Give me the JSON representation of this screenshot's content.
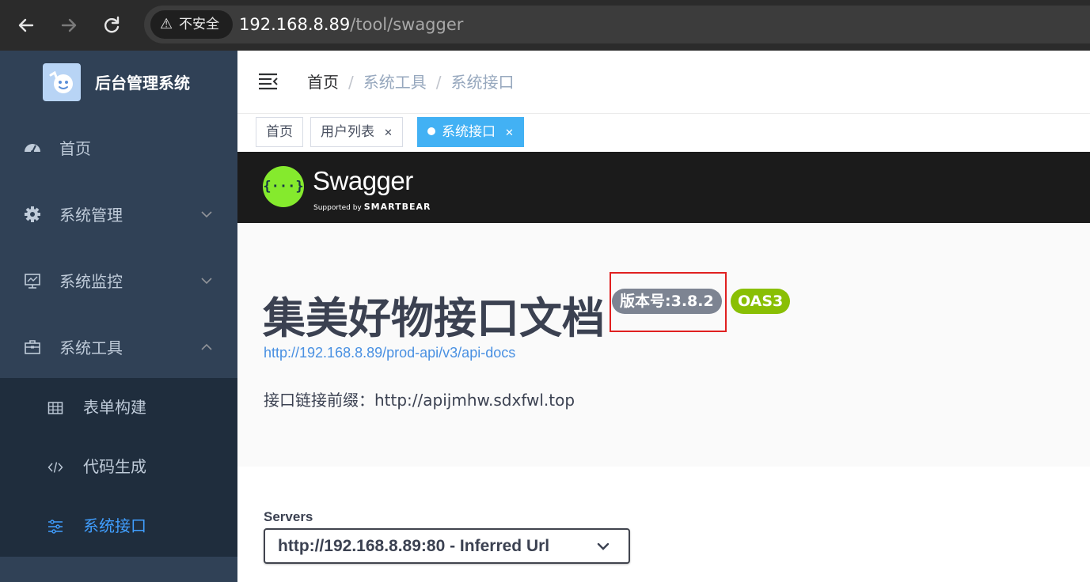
{
  "browser": {
    "security_label": "不安全",
    "url_host": "192.168.8.89",
    "url_path": "/tool/swagger"
  },
  "sidebar": {
    "title": "后台管理系统",
    "items": [
      {
        "label": "首页",
        "icon": "dashboard-icon"
      },
      {
        "label": "系统管理",
        "icon": "gear-icon"
      },
      {
        "label": "系统监控",
        "icon": "monitor-icon"
      },
      {
        "label": "系统工具",
        "icon": "toolbox-icon"
      }
    ],
    "subitems": [
      {
        "label": "表单构建",
        "icon": "table-icon"
      },
      {
        "label": "代码生成",
        "icon": "code-icon"
      },
      {
        "label": "系统接口",
        "icon": "sliders-icon",
        "active": true
      }
    ]
  },
  "header": {
    "breadcrumb": [
      "首页",
      "系统工具",
      "系统接口"
    ]
  },
  "tags": [
    {
      "label": "首页"
    },
    {
      "label": "用户列表",
      "closable": true
    },
    {
      "label": "系统接口",
      "closable": true,
      "active": true
    }
  ],
  "swagger": {
    "brand": "Swagger",
    "supported_by": "Supported by",
    "smartbear": "SMARTBEAR",
    "title": "集美好物接口文档",
    "version": "版本号:3.8.2",
    "oas": "OAS3",
    "docs_url": "http://192.168.8.89/prod-api/v3/api-docs",
    "description": "接口链接前缀：http://apijmhw.sdxfwl.top",
    "servers_label": "Servers",
    "server_selected": "http://192.168.8.89:80 - Inferred Url"
  },
  "colors": {
    "sidebar_bg": "#304156",
    "submenu_bg": "#1f2d3d",
    "active_blue": "#409eff",
    "swagger_green": "#85ea2d",
    "oas_green": "#89bf04",
    "highlight_red": "#e02020"
  }
}
